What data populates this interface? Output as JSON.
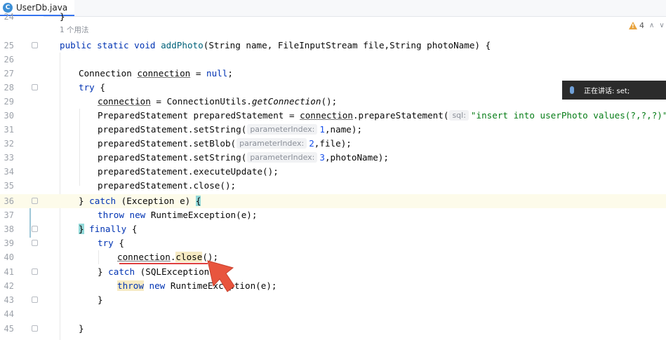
{
  "tab": {
    "icon_letter": "C",
    "label": "UserDb.java"
  },
  "inspections": {
    "warning_count": "4",
    "up": "∧",
    "down": "∨"
  },
  "overlay": {
    "text": "正在讲话: set;"
  },
  "usage_hint": "1 个用法",
  "line_numbers": [
    "24",
    "25",
    "26",
    "27",
    "28",
    "29",
    "30",
    "31",
    "32",
    "33",
    "34",
    "35",
    "36",
    "37",
    "38",
    "39",
    "40",
    "41",
    "42",
    "43",
    "44",
    "45"
  ],
  "code": {
    "l24": "}",
    "l25": {
      "kw": "public static void ",
      "fn": "addPhoto",
      "rest": "(String name, FileInputStream file,String photoName) {"
    },
    "l27": {
      "type": "Connection ",
      "var": "connection",
      "mid": " = ",
      "kw": "null",
      "end": ";"
    },
    "l28": {
      "kw": "try",
      "end": " {"
    },
    "l29": {
      "var": "connection",
      "mid": " = ConnectionUtils.",
      "fn": "getConnection",
      "end": "();"
    },
    "l30": {
      "pre": "PreparedStatement preparedStatement = ",
      "var": "connection",
      "mid": ".prepareStatement(",
      "hint": "sql:",
      "str": "\"insert into userPhoto values(?,?,?)\"",
      "end": ");"
    },
    "l31": {
      "pre": "preparedStatement.setString(",
      "hint": "parameterIndex:",
      "num": "1",
      "end": ",name);"
    },
    "l32": {
      "pre": "preparedStatement.setBlob(",
      "hint": "parameterIndex:",
      "num": "2",
      "end": ",file);"
    },
    "l33": {
      "pre": "preparedStatement.setString(",
      "hint": "parameterIndex:",
      "num": "3",
      "end": ",photoName);"
    },
    "l34": "preparedStatement.executeUpdate();",
    "l35": "preparedStatement.close();",
    "l36": {
      "brace": "}",
      "kw": " catch ",
      "mid": "(Exception e) ",
      "open": "{"
    },
    "l37": {
      "kw": "throw new ",
      "end": "RuntimeException(e);"
    },
    "l38": {
      "brace": "}",
      "kw": " finally",
      "end": " {"
    },
    "l39": {
      "kw": "try",
      "end": " {"
    },
    "l40": {
      "var": "connection",
      "dot": ".",
      "mark": "close",
      "end": "();"
    },
    "l41": {
      "brace": "} ",
      "kw": "catch",
      "end": " (SQLException e)"
    },
    "l42": {
      "mark": "throw",
      "kw": " new ",
      "end": "RuntimeException(e);"
    },
    "l43": "}",
    "l45": "}"
  },
  "colors": {
    "keyword": "#0033b3",
    "string": "#067d17",
    "number": "#1750eb",
    "method": "#00627a",
    "accent": "#3574f0",
    "arrow": "#e8553e"
  },
  "icons": [
    "java-class-icon",
    "warning-icon",
    "microphone-icon",
    "cursor-arrow-icon"
  ]
}
